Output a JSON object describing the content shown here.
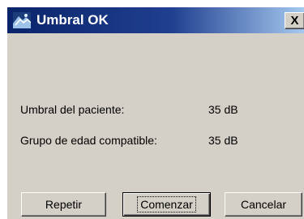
{
  "window": {
    "title": "Umbral OK",
    "close_label": "X"
  },
  "fields": [
    {
      "label": "Umbral del paciente:",
      "value": "35 dB"
    },
    {
      "label": "Grupo de edad compatible:",
      "value": "35 dB"
    }
  ],
  "buttons": {
    "repeat": "Repetir",
    "start": "Comenzar",
    "cancel": "Cancelar"
  },
  "colors": {
    "titlebar_start": "#0a246a",
    "titlebar_end": "#a6caf0",
    "face": "#d4d0c8"
  },
  "icons": {
    "app": "audiometer-app-icon",
    "close": "close-icon"
  }
}
